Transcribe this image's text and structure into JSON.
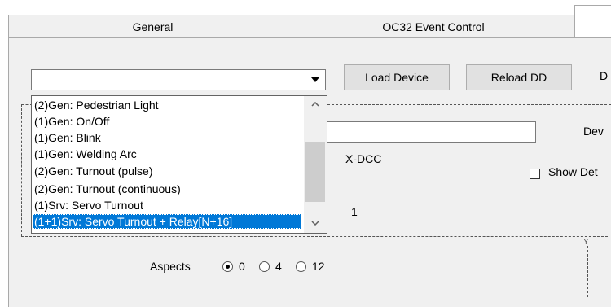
{
  "tabs": [
    "General",
    "OC32 Event Control"
  ],
  "toolbar": {
    "device_value": "",
    "load_device_label": "Load Device",
    "reload_dd_label": "Reload DD",
    "cut_label": "D"
  },
  "dropdown": {
    "items": [
      "(2)Gen: Pedestrian Light",
      "(1)Gen: On/Off",
      "(1)Gen: Blink",
      "(1)Gen: Welding Arc",
      "(2)Gen: Turnout (pulse)",
      "(2)Gen: Turnout (continuous)",
      "(1)Srv: Servo Turnout",
      "(1+1)Srv: Servo Turnout + Relay[N+16]"
    ],
    "selected_index": 7
  },
  "form": {
    "name_value": "",
    "dev_label": "Dev",
    "protocol_value": "X-DCC",
    "show_det_label": "Show Det",
    "count_value": "1"
  },
  "aspects": {
    "label": "Aspects",
    "options": [
      "0",
      "4",
      "12"
    ],
    "selected": "0"
  }
}
